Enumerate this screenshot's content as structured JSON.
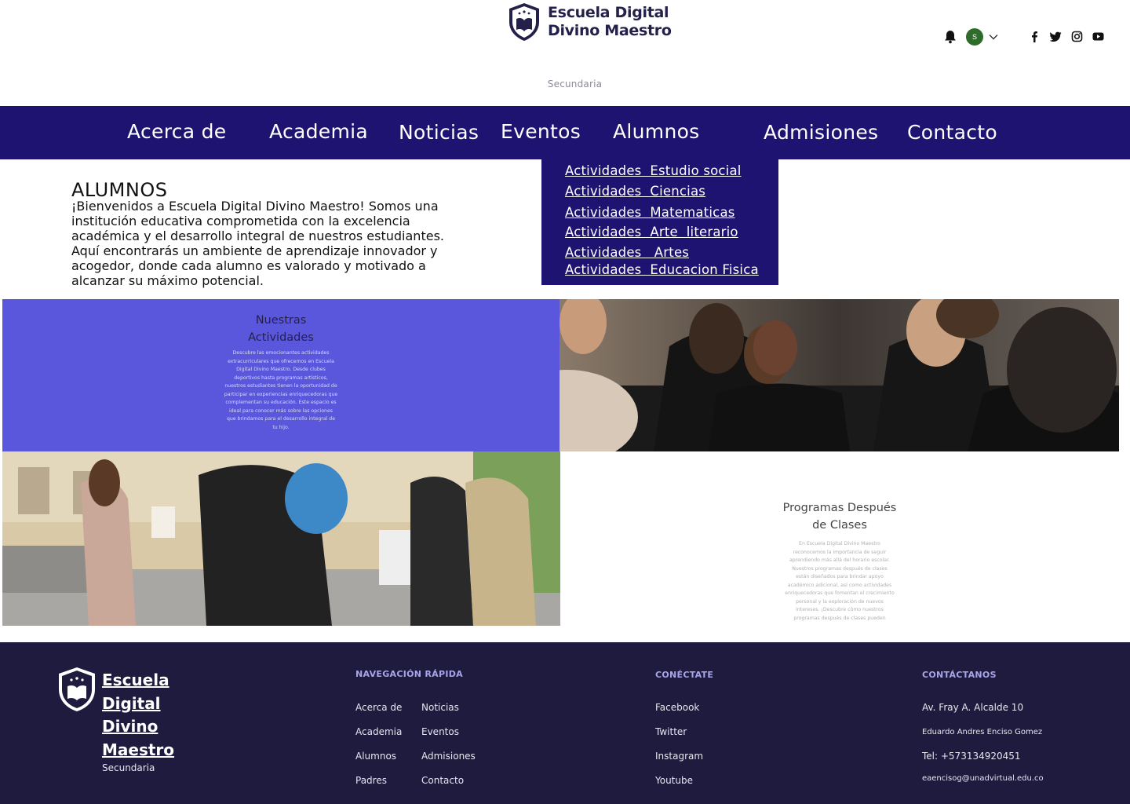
{
  "header": {
    "brand_line1": "Escuela Digital",
    "brand_line2": "Divino Maestro",
    "subtitle": "Secundaria",
    "avatar_initial": "S",
    "icons": [
      "bell-icon",
      "chevron-down-icon",
      "facebook-icon",
      "twitter-icon",
      "instagram-icon",
      "youtube-icon"
    ]
  },
  "nav": {
    "items": [
      "Acerca de",
      "Academia",
      "Noticias",
      "Eventos",
      "Alumnos",
      "Admisiones",
      "Contacto"
    ]
  },
  "dropdown": {
    "items": [
      "Actividades  Estudio social",
      "Actividades  Ciencias",
      "Actividades  Matematicas",
      "Actividades  Arte  literario",
      "Actividades   Artes",
      "Actividades  Educacion Fisica"
    ]
  },
  "intro": {
    "title": "ALUMNOS",
    "body": "¡Bienvenidos a Escuela Digital Divino Maestro! Somos una institución educativa comprometida con la excelencia académica y el desarrollo integral de nuestros estudiantes. Aquí encontrarás un ambiente de aprendizaje innovador y acogedor, donde cada alumno es valorado y motivado a alcanzar su máximo potencial."
  },
  "activities": {
    "title_line1": "Nuestras",
    "title_line2": "Actividades",
    "text": "Descubre las emocionantes actividades extracurriculares que ofrecemos en Escuela Digital Divino Maestro. Desde clubes deportivos hasta programas artísticos, nuestros estudiantes tienen la oportunidad de participar en experiencias enriquecedoras que complementan su educación. Este espacio es ideal para conocer más sobre las opciones que brindamos para el desarrollo integral de tu hijo."
  },
  "programs": {
    "title_line1": "Programas Después",
    "title_line2": "de Clases",
    "text": "En Escuela Digital Divino Maestro reconocemos la importancia de seguir aprendiendo más allá del horario escolar. Nuestros programas después de clases están diseñados para brindar apoyo académico adicional, así como actividades enriquecedoras que fomentan el crecimiento personal y la exploración de nuevos intereses. ¡Descubre cómo nuestros programas después de clases pueden"
  },
  "footer": {
    "brand": "Escuela Digital Divino Maestro",
    "subtitle": "Secundaria",
    "nav_heading": "NAVEGACIÓN RÁPIDA",
    "nav_col1": [
      "Acerca de",
      "Academia",
      "Alumnos",
      "Padres"
    ],
    "nav_col2": [
      "Noticias",
      "Eventos",
      "Admisiones",
      "Contacto"
    ],
    "connect_heading": "CONÉCTATE",
    "connect": [
      "Facebook",
      "Twitter",
      "Instagram",
      "Youtube"
    ],
    "contact_heading": "CONTÁCTANOS",
    "address": "Av. Fray A. Alcalde 10",
    "person": "Eduardo Andres Enciso Gomez",
    "phone": "Tel: +573134920451",
    "email": "eaencisog@unadvirtual.edu.co"
  },
  "colors": {
    "nav_bg": "#1f1371",
    "activities_bg": "#5a57dc",
    "footer_bg": "#1f1b3f",
    "brand_text": "#23214a",
    "avatar_bg": "#2f6b2a"
  }
}
